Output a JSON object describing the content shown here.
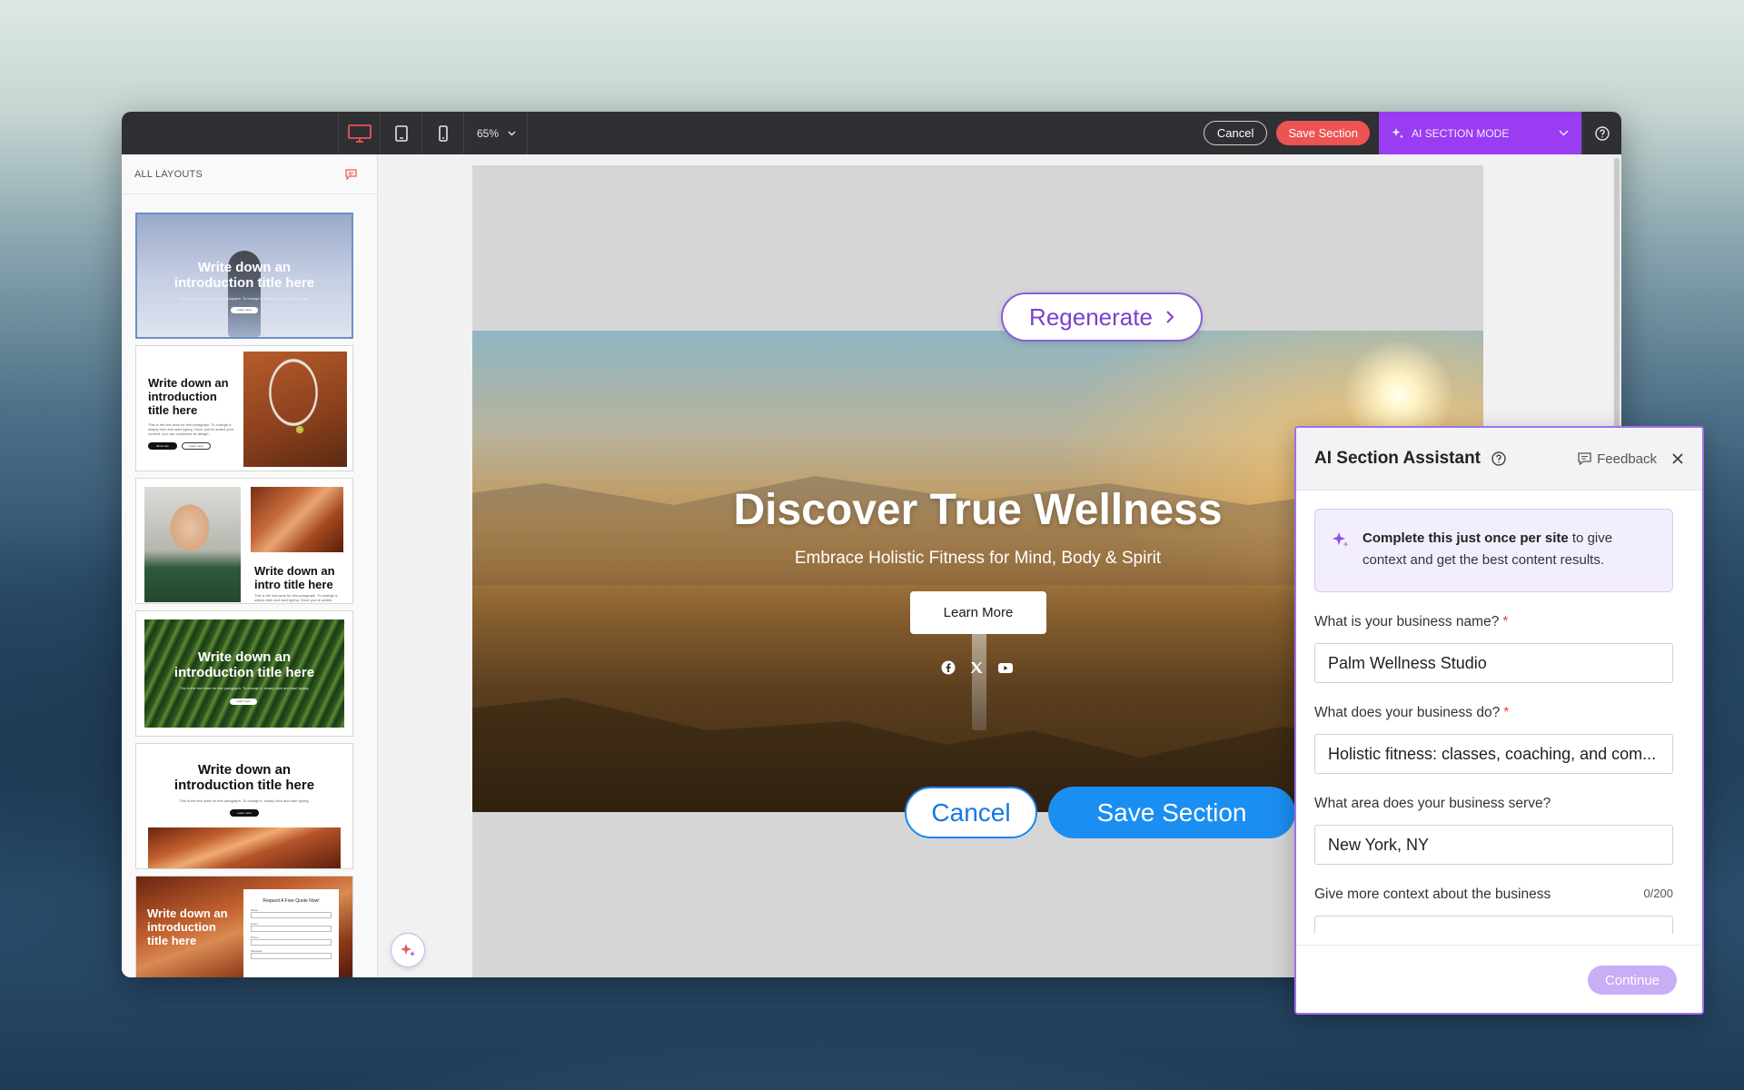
{
  "toolbar": {
    "zoom": "65%",
    "cancel_label": "Cancel",
    "save_label": "Save Section",
    "ai_mode_label": "AI SECTION MODE",
    "accent": "#9a3cf2",
    "save_color": "#ee5353"
  },
  "layouts": {
    "header": "ALL LAYOUTS",
    "items": [
      {
        "title": "Write down an introduction title here",
        "body": "This is the text area for this paragraph. To change it, simply click and start typing.",
        "button": "Learn more"
      },
      {
        "title": "Write down an introduction title here",
        "body": "This is the text area for this paragraph. To change it, simply click and start typing. Once you've added your content, you can customize its design.",
        "button_primary": "Book now",
        "button_secondary": "Learn more"
      },
      {
        "title": "Write down an intro title here",
        "body": "This is the text area for this paragraph. To change it, simply click and start typing. Once you've added"
      },
      {
        "title": "Write down an introduction title here",
        "body": "This is the text area for this paragraph. To change it, simply click and start typing.",
        "button": "Learn more"
      },
      {
        "title": "Write down an introduction title here",
        "body": "This is the text area for this paragraph. To change it, simply click and start typing.",
        "button": "Learn more"
      },
      {
        "title": "Write down an introduction title here",
        "form_title": "Request A Free Quote Now!",
        "form_fields": [
          "Name",
          "Email",
          "Phone",
          "Message"
        ]
      }
    ]
  },
  "hero": {
    "regenerate_label": "Regenerate",
    "title": "Discover True Wellness",
    "subtitle": "Embrace Holistic Fitness for Mind, Body & Spirit",
    "button": "Learn More",
    "socials": [
      "facebook-icon",
      "x-icon",
      "youtube-icon"
    ],
    "cancel_label": "Cancel",
    "save_label": "Save Section",
    "save_color": "#1b8ef2"
  },
  "assistant": {
    "title": "AI Section Assistant",
    "feedback_label": "Feedback",
    "notice_bold": "Complete this just once per site",
    "notice_rest": " to give context and get the best content results.",
    "questions": [
      {
        "label": "What is your business name?",
        "required": "*",
        "value": "Palm Wellness Studio"
      },
      {
        "label": "What does your business do?",
        "required": "*",
        "value": "Holistic fitness: classes, coaching, and com..."
      },
      {
        "label": "What area does your business serve?",
        "value": "New York, NY"
      }
    ],
    "context_label": "Give more context about the business",
    "context_counter": "0/200",
    "continue_label": "Continue"
  }
}
